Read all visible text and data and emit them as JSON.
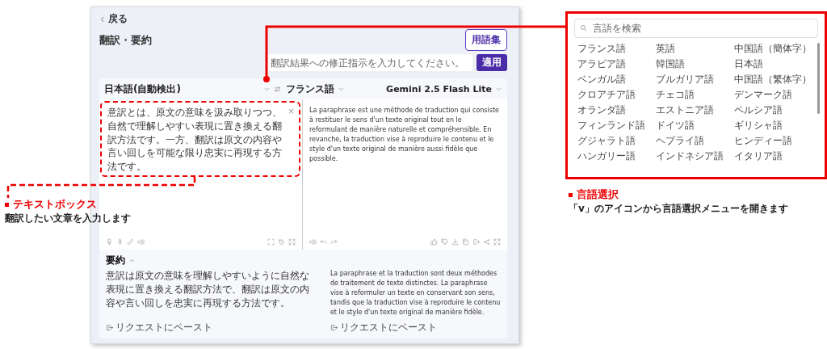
{
  "back_link": "戻る",
  "title": "翻訳・要約",
  "glossary_button": "用語集",
  "instruction_field": {
    "placeholder": "翻訳結果への修正指示を入力してください。"
  },
  "apply_button": "適用",
  "source_language": "日本語(自動検出)",
  "target_language": "フランス語",
  "model": "Gemini 2.5 Flash Lite",
  "source_text": "意訳とは、原文の意味を汲み取りつつ、自然で理解しやすい表現に置き換える翻訳方法です。一方、翻訳は原文の内容や言い回しを可能な限り忠実に再現する方法です。",
  "clear_button": "×",
  "translation": "La paraphrase est une méthode de traduction qui consiste à restituer le sens d'un texte original tout en le reformulant de manière naturelle et compréhensible. En revanche, la traduction vise à reproduire le contenu et le style d'un texte original de manière aussi fidèle que possible.",
  "summary": {
    "label": "要約",
    "expanded": true,
    "source": "意訳は原文の意味を理解しやすいように自然な表現に置き換える翻訳方法で、翻訳は原文の内容や言い回しを忠実に再現する方法です。",
    "target": "La paraphrase et la traduction sont deux méthodes de traitement de texte distinctes. La paraphrase vise à reformuler un texte en conservant son sens, tandis que la traduction vise à reproduire le contenu et le style d'un texte original de manière fidèle.",
    "paste_buttons": [
      "リクエストにペースト",
      "リクエストにペースト"
    ]
  },
  "language_menu": {
    "search": {
      "placeholder": "言語を検索"
    },
    "languages": [
      "フランス語",
      "英語",
      "中国語（簡体字）",
      "アラビア語",
      "韓国語",
      "日本語",
      "ベンガル語",
      "ブルガリア語",
      "中国語（繁体字）",
      "クロアチア語",
      "チェコ語",
      "デンマーク語",
      "オランダ語",
      "エストニア語",
      "ペルシア語",
      "フィンランド語",
      "ドイツ語",
      "ギリシャ語",
      "グジャラト語",
      "ヘブライ語",
      "ヒンディー語",
      "ハンガリー語",
      "インドネシア語",
      "イタリア語"
    ]
  },
  "annotations": [
    {
      "title": "テキストボックス",
      "text": "翻訳したい文章を入力します"
    },
    {
      "title": "言語選択",
      "text": "「v」のアイコンから言語選択メニューを開きます"
    }
  ]
}
